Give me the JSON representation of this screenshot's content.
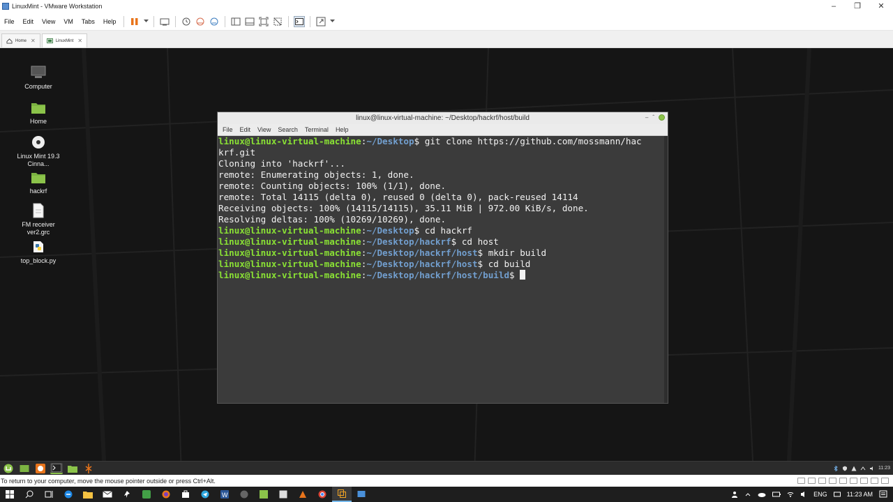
{
  "window": {
    "title": "LinuxMint - VMware Workstation"
  },
  "menubar": {
    "items": [
      "File",
      "Edit",
      "View",
      "VM",
      "Tabs",
      "Help"
    ]
  },
  "tabs": [
    {
      "label": "Home",
      "icon": "home-icon"
    },
    {
      "label": "LinuxMint",
      "icon": "vm-icon"
    }
  ],
  "desktop": {
    "icons": [
      {
        "label": "Computer",
        "icon": "computer-icon"
      },
      {
        "label": "Home",
        "icon": "folder-icon"
      },
      {
        "label": "Linux Mint 19.3 Cinna...",
        "icon": "disc-icon"
      },
      {
        "label": "hackrf",
        "icon": "folder-icon"
      },
      {
        "label": "FM receiver ver2.grc",
        "icon": "file-icon"
      },
      {
        "label": "top_block.py",
        "icon": "python-icon"
      }
    ]
  },
  "terminal": {
    "title": "linux@linux-virtual-machine: ~/Desktop/hackrf/host/build",
    "menu": [
      "File",
      "Edit",
      "View",
      "Search",
      "Terminal",
      "Help"
    ],
    "lines": [
      {
        "user": "linux@linux-virtual-machine",
        "path": "~/Desktop",
        "cmd": " git clone https://github.com/mossmann/hac"
      },
      {
        "text": "krf.git"
      },
      {
        "text": "Cloning into 'hackrf'..."
      },
      {
        "text": "remote: Enumerating objects: 1, done."
      },
      {
        "text": "remote: Counting objects: 100% (1/1), done."
      },
      {
        "text": "remote: Total 14115 (delta 0), reused 0 (delta 0), pack-reused 14114"
      },
      {
        "text": "Receiving objects: 100% (14115/14115), 35.11 MiB | 972.00 KiB/s, done."
      },
      {
        "text": "Resolving deltas: 100% (10269/10269), done."
      },
      {
        "user": "linux@linux-virtual-machine",
        "path": "~/Desktop",
        "cmd": " cd hackrf"
      },
      {
        "user": "linux@linux-virtual-machine",
        "path": "~/Desktop/hackrf",
        "cmd": " cd host"
      },
      {
        "user": "linux@linux-virtual-machine",
        "path": "~/Desktop/hackrf/host",
        "cmd": " mkdir build"
      },
      {
        "user": "linux@linux-virtual-machine",
        "path": "~/Desktop/hackrf/host",
        "cmd": " cd build"
      },
      {
        "user": "linux@linux-virtual-machine",
        "path": "~/Desktop/hackrf/host/build",
        "cmd": " ",
        "cursor": true
      }
    ]
  },
  "guest_panel": {
    "clock": "11:23"
  },
  "status_bar": {
    "text": "To return to your computer, move the mouse pointer outside or press Ctrl+Alt."
  },
  "win_taskbar": {
    "lang": "ENG",
    "time": "11:23 AM"
  },
  "colors": {
    "prompt_user": "#8ae234",
    "prompt_path": "#729fcf",
    "pause_accent": "#e8741b"
  }
}
